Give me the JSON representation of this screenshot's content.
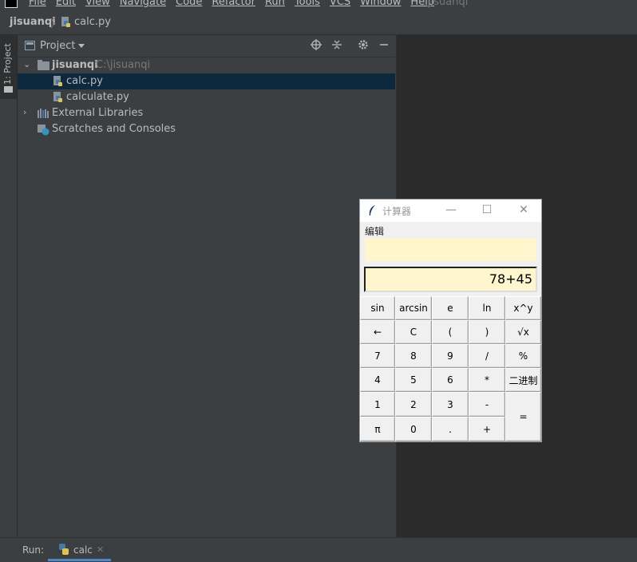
{
  "menubar": {
    "items": [
      "File",
      "Edit",
      "View",
      "Navigate",
      "Code",
      "Refactor",
      "Run",
      "Tools",
      "VCS",
      "Window",
      "Help"
    ],
    "window_title": "jisuanqi"
  },
  "breadcrumb": {
    "project": "jisuanqi",
    "file": "calc.py"
  },
  "left_strip": {
    "project_tab": "1: Project"
  },
  "project_panel": {
    "title": "Project",
    "tree": {
      "root_name": "jisuanqi",
      "root_path": "C:\\jisuanqi",
      "files": [
        "calc.py",
        "calculate.py"
      ],
      "external_libraries": "External Libraries",
      "scratches": "Scratches and Consoles"
    }
  },
  "bottom_bar": {
    "run_label": "Run:",
    "tab_label": "calc"
  },
  "calculator": {
    "title": "计算器",
    "menu": "编辑",
    "display_top": "",
    "display_main": "78+45",
    "keys": {
      "r1": [
        "sin",
        "arcsin",
        "e",
        "ln",
        "x^y"
      ],
      "r2": [
        "←",
        "C",
        "(",
        ")",
        "√x"
      ],
      "r3": [
        "7",
        "8",
        "9",
        "/",
        "%"
      ],
      "r4": [
        "4",
        "5",
        "6",
        "*",
        "二进制"
      ],
      "r5": [
        "1",
        "2",
        "3",
        "-"
      ],
      "r6": [
        "π",
        "0",
        ".",
        "+"
      ],
      "equals": "="
    }
  },
  "colors": {
    "ide_bg": "#3c3f41",
    "editor_bg": "#2b2b2b",
    "selection": "#0d293e",
    "display_bg": "#fff6ce",
    "accent": "#4a88c7"
  }
}
